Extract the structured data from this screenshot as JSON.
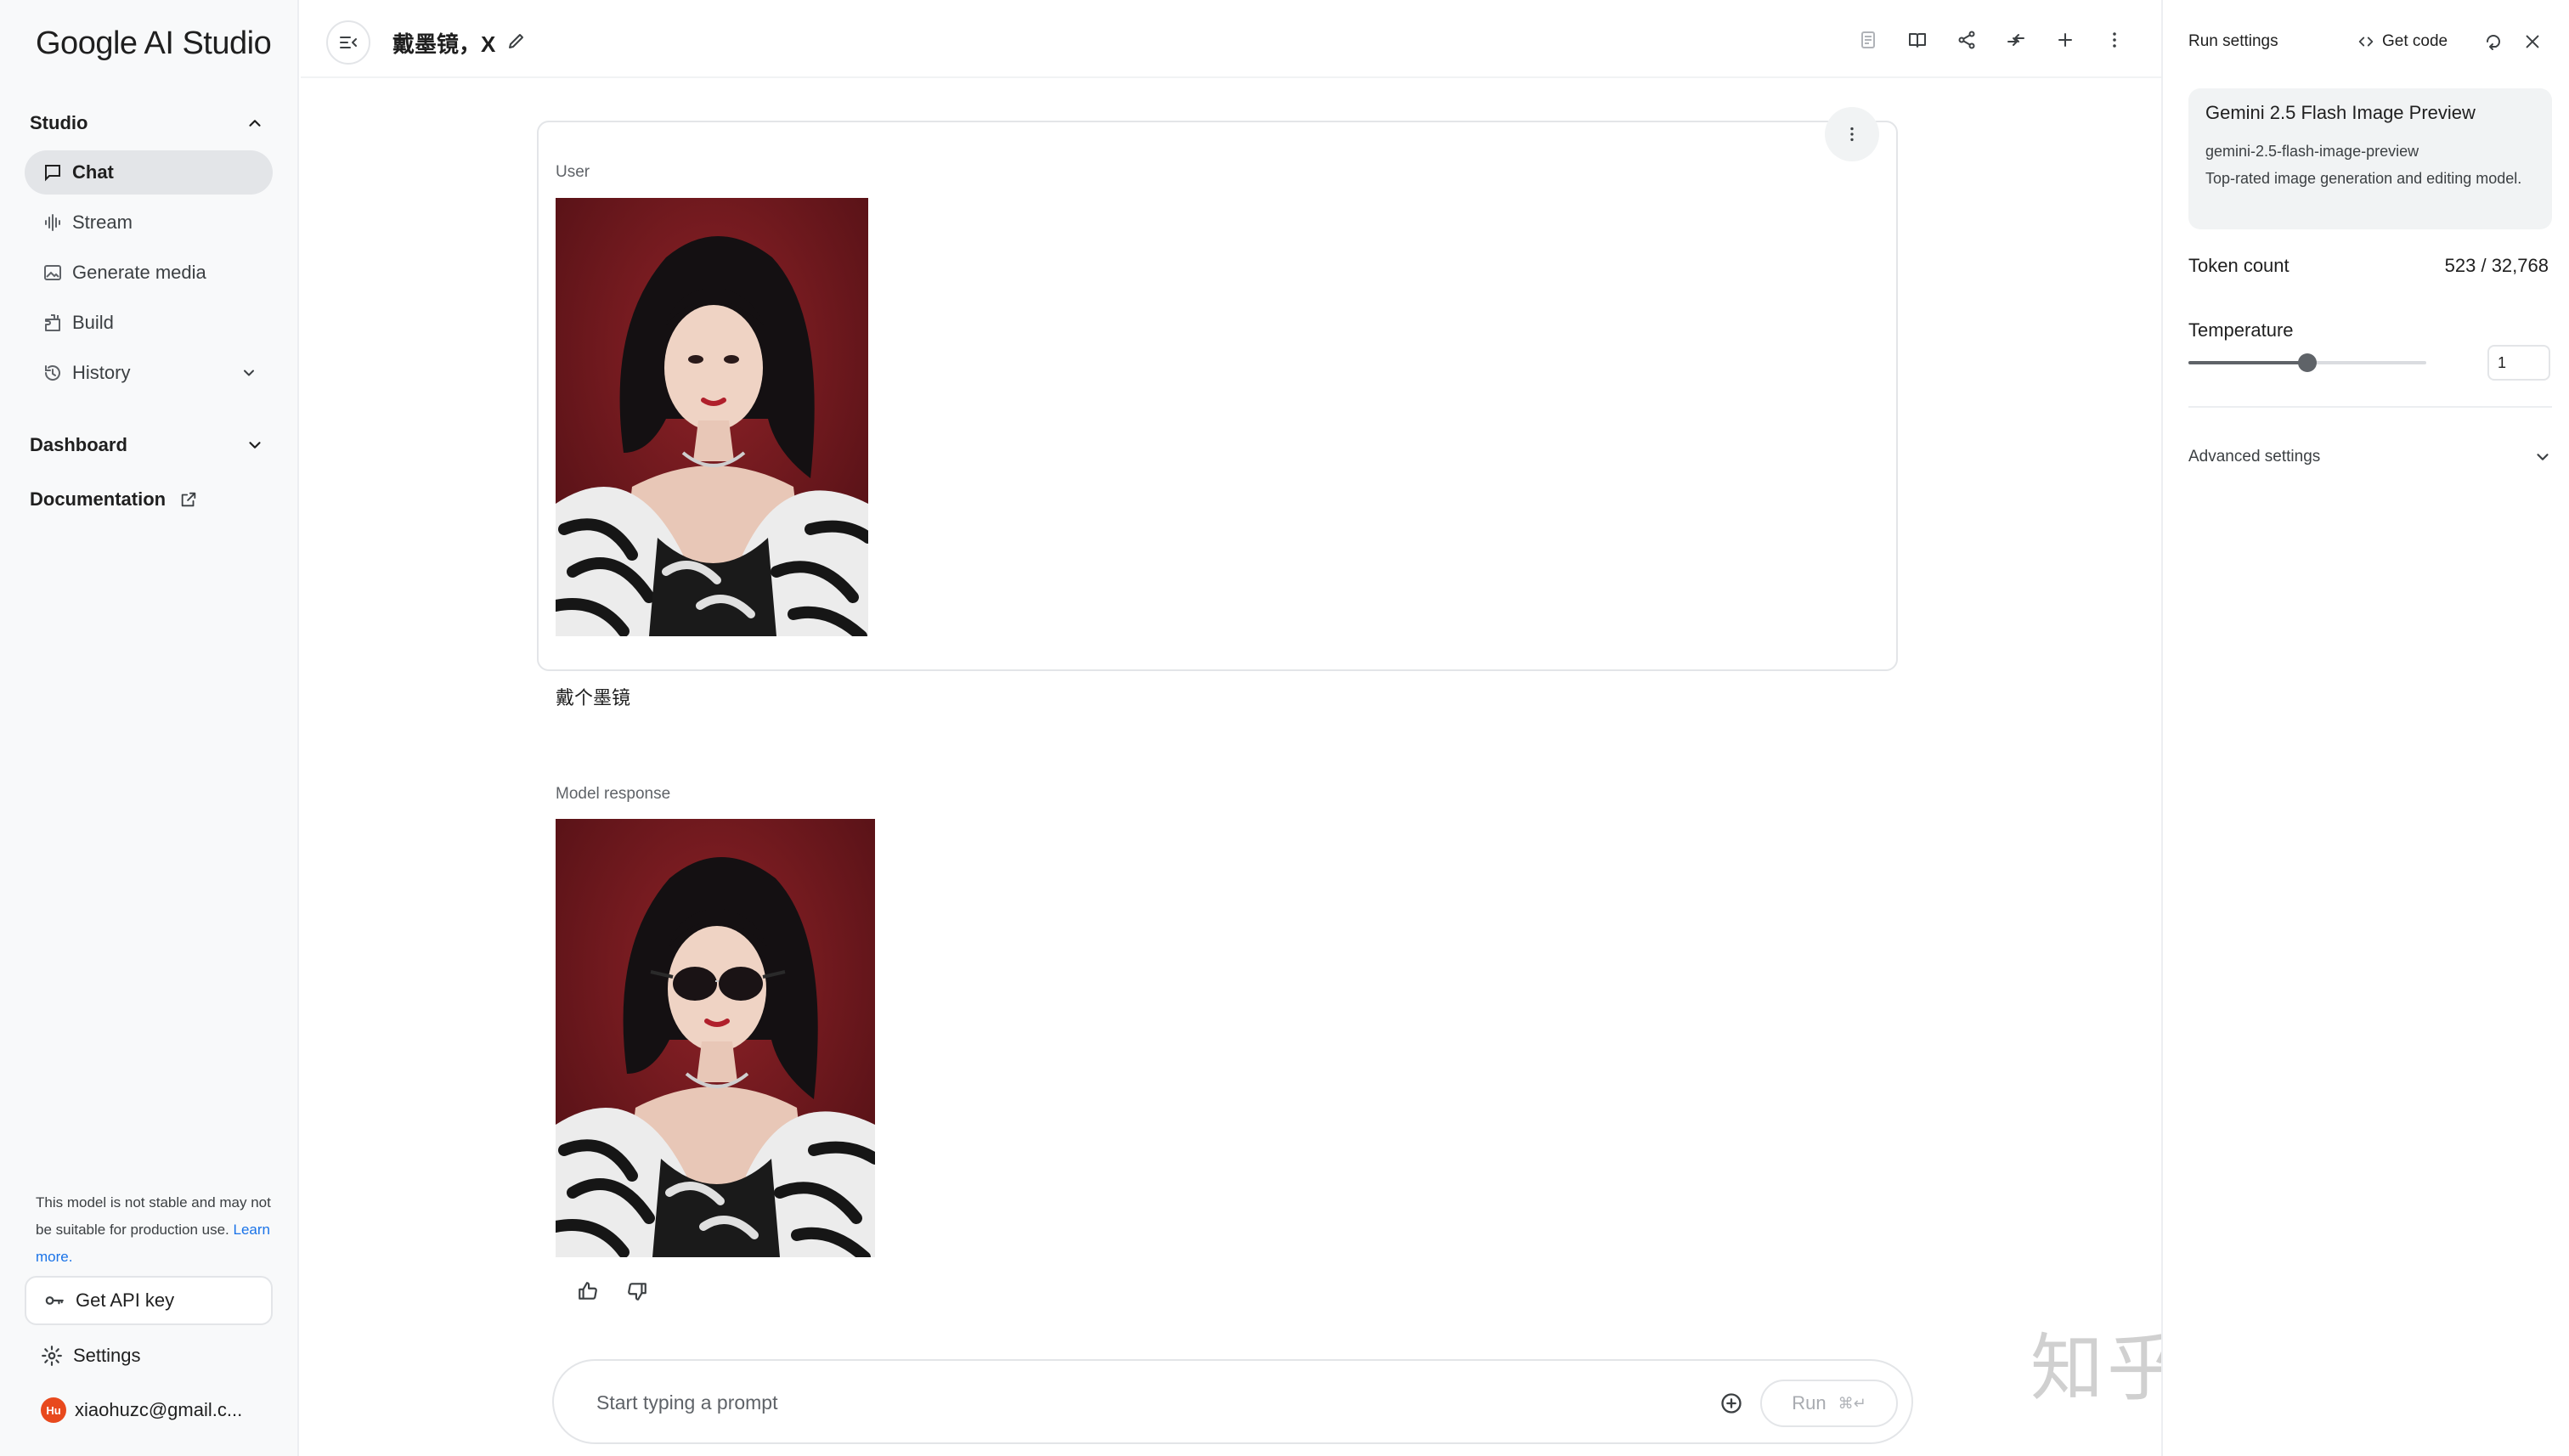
{
  "app": {
    "logo": "Google AI Studio"
  },
  "sidebar": {
    "studio_label": "Studio",
    "items": [
      {
        "label": "Chat",
        "icon": "chat-icon",
        "active": true
      },
      {
        "label": "Stream",
        "icon": "stream-icon"
      },
      {
        "label": "Generate media",
        "icon": "image-icon"
      },
      {
        "label": "Build",
        "icon": "build-icon"
      },
      {
        "label": "History",
        "icon": "history-icon"
      }
    ],
    "dashboard_label": "Dashboard",
    "documentation_label": "Documentation",
    "disclaimer": "This model is not stable and may not be suitable for production use.",
    "learn_more": "Learn more.",
    "api_key_label": "Get API key",
    "settings_label": "Settings",
    "account": {
      "email": "xiaohuzc@gmail.c...",
      "avatar_initials": "Hu",
      "avatar_color": "#e8491d"
    }
  },
  "header": {
    "title": "戴墨镜，X"
  },
  "chat": {
    "user": {
      "role_label": "User",
      "image_label": "photo: woman with dark hair in black-and-white fur, red background",
      "prompt": "戴个墨镜"
    },
    "model": {
      "role_label": "Model response",
      "image_label": "photo: same woman wearing dark sunglasses"
    }
  },
  "prompt_bar": {
    "placeholder": "Start typing a prompt",
    "run_label": "Run",
    "run_shortcut": "⌘↵"
  },
  "run_settings": {
    "title": "Run settings",
    "get_code_label": "Get code",
    "model": {
      "name": "Gemini 2.5 Flash Image Preview",
      "id": "gemini-2.5-flash-image-preview",
      "description": "Top-rated image generation and editing model."
    },
    "token_count_label": "Token count",
    "token_count_value": "523 / 32,768",
    "temperature_label": "Temperature",
    "temperature_value": "1",
    "temperature_fraction": 0.5,
    "advanced_label": "Advanced settings"
  },
  "watermark": "知乎 @小小将",
  "colors": {
    "accent": "#1a73e8",
    "photo_bg": "#7a1a1f"
  }
}
